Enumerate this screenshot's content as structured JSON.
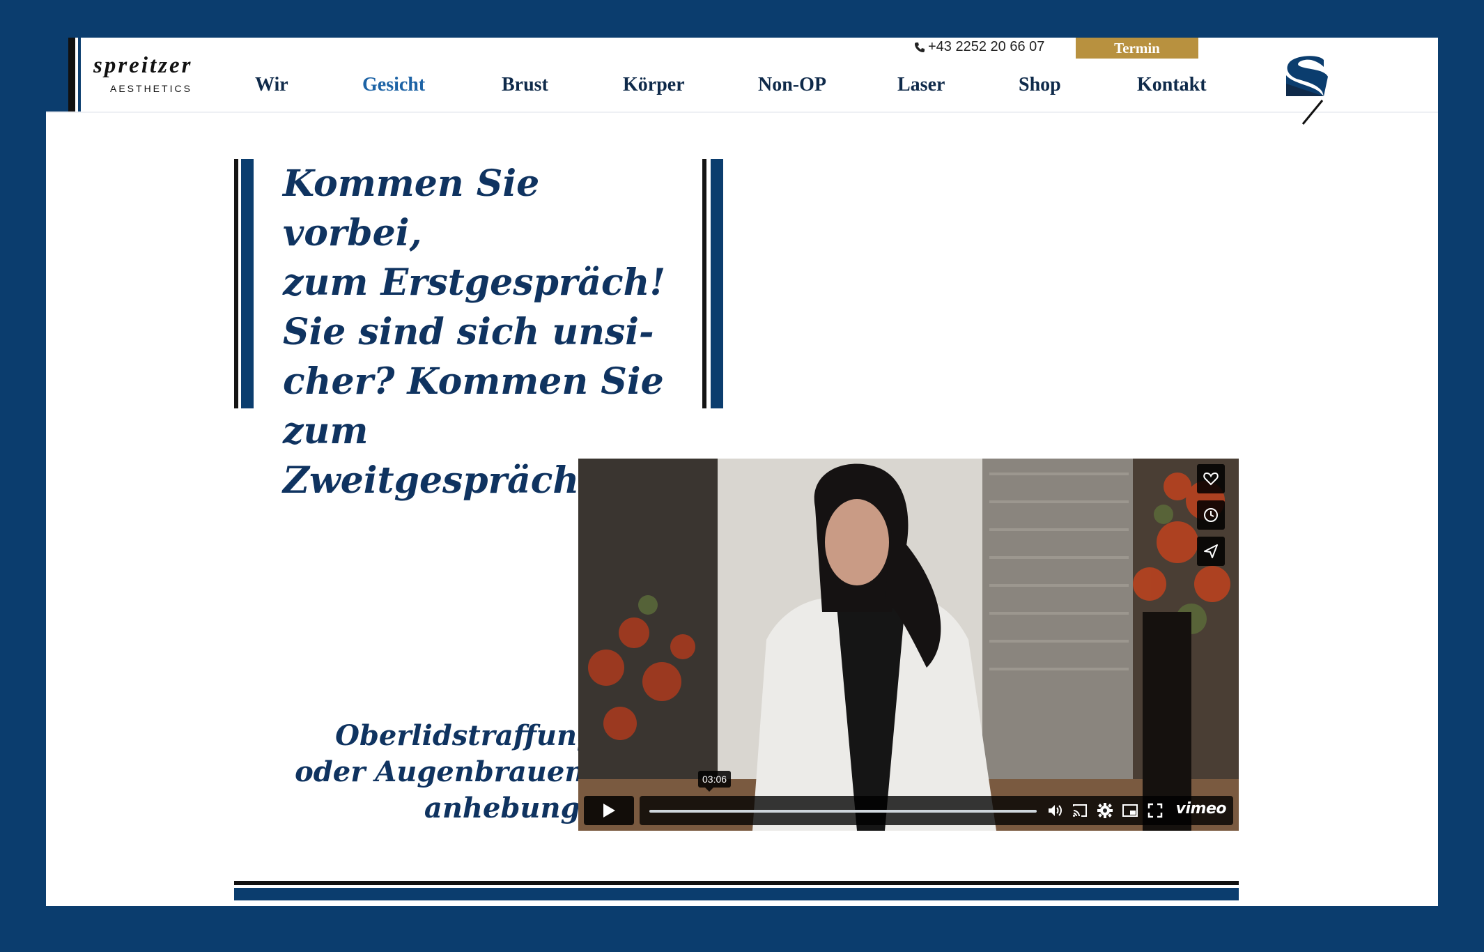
{
  "header": {
    "brand_name": "spreitzer",
    "brand_sub": "AESTHETICS",
    "phone": "+43 2252 20 66 07",
    "termin_label": "Termin",
    "nav": [
      {
        "label": "Wir",
        "active": false
      },
      {
        "label": "Gesicht",
        "active": true
      },
      {
        "label": "Brust",
        "active": false
      },
      {
        "label": "Körper",
        "active": false
      },
      {
        "label": "Non-OP",
        "active": false
      },
      {
        "label": "Laser",
        "active": false
      },
      {
        "label": "Shop",
        "active": false
      },
      {
        "label": "Kontakt",
        "active": false
      }
    ]
  },
  "main": {
    "quote": "Kommen Sie vorbei, zum Erstgespräch! Sie sind sich unsi-cher? Kommen Sie zum Zweitgespräch.",
    "quote_lines": [
      "Kommen Sie vorbei,",
      "zum Erstgespräch!",
      "Sie sind sich unsi-",
      "cher? Kommen Sie",
      "zum Zweitgespräch."
    ],
    "video_heading_lines": [
      "Oberlidstraffung",
      "oder Augenbrauen-",
      "anhebung?"
    ],
    "video": {
      "time": "03:06",
      "brand": "vimeo",
      "progress": 0
    }
  },
  "colors": {
    "navy": "#0b3d6e",
    "text_navy": "#0f3360",
    "active_nav": "#1d63a5",
    "gold": "#b8913f"
  },
  "icons": [
    "phone-icon",
    "heart-icon",
    "clock-icon",
    "share-icon",
    "play-icon",
    "volume-icon",
    "cast-icon",
    "settings-icon",
    "pip-icon",
    "fullscreen-icon"
  ]
}
